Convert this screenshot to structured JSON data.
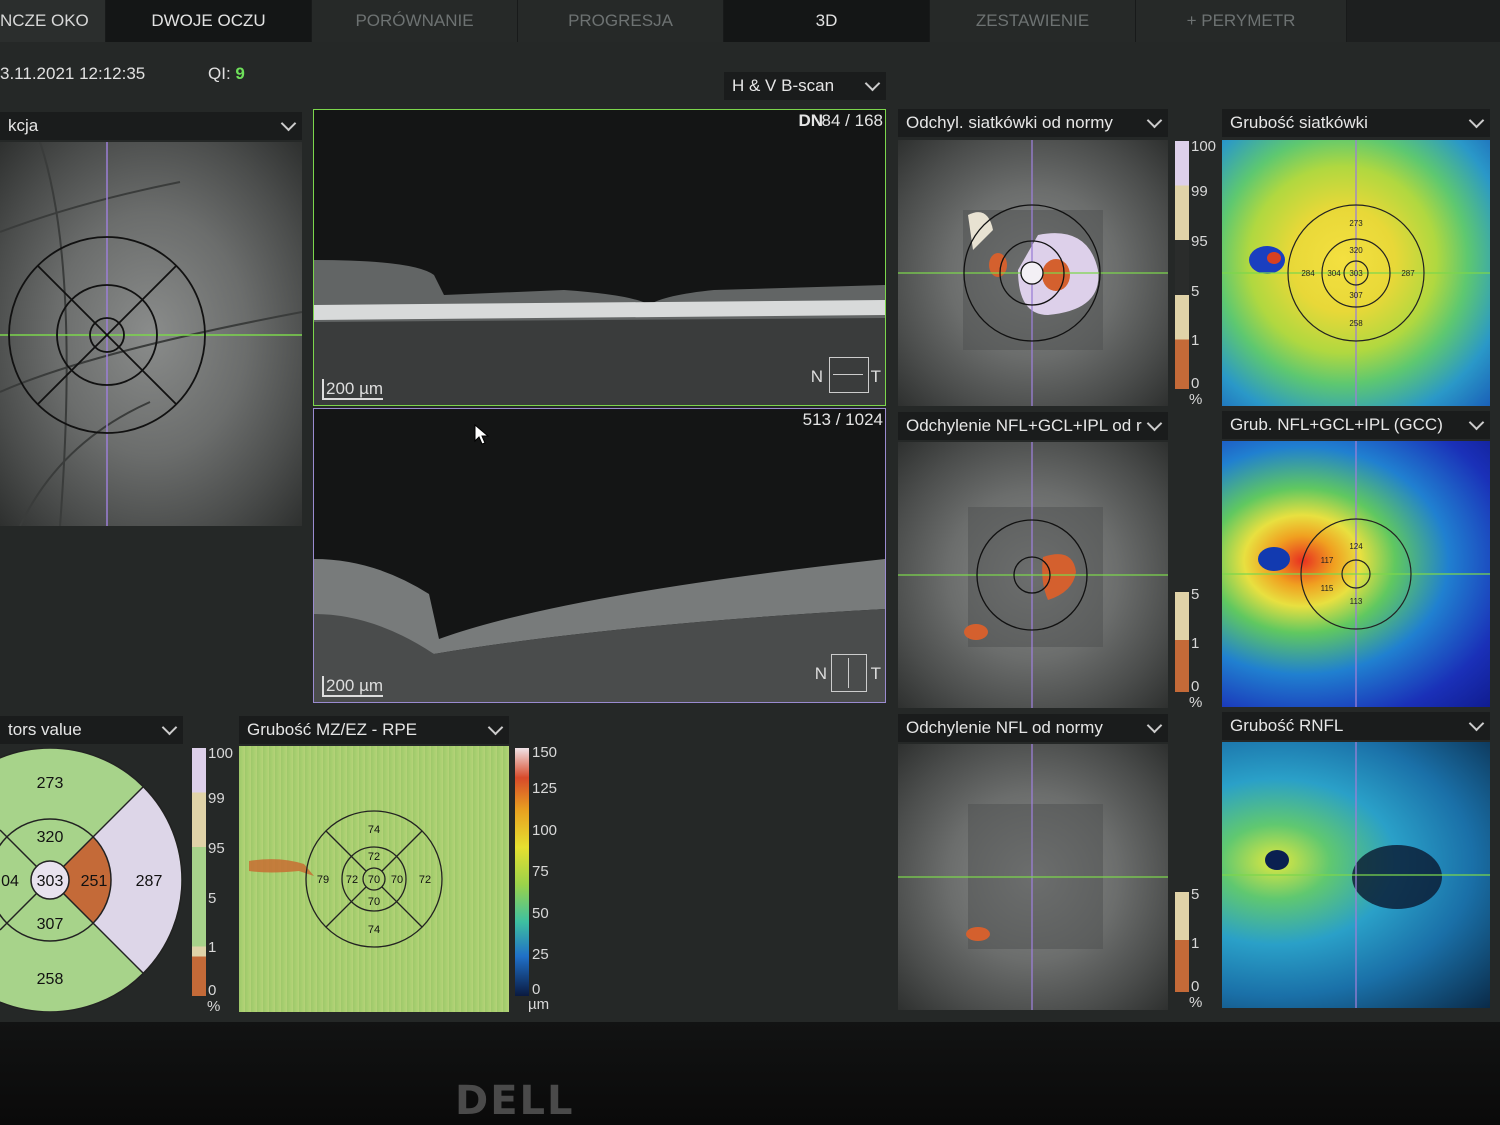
{
  "tabs": [
    "NCZE OKO",
    "DWOJE OCZU",
    "PORÓWNANIE",
    "PROGRESJA",
    "3D",
    "ZESTAWIENIE",
    "+ PERYMETR"
  ],
  "header": {
    "datetime": "3.11.2021 12:12:35",
    "qi_label": "QI:",
    "qi_value": "9"
  },
  "bscan_selector": "H & V B-scan",
  "left_panel": {
    "title": "kcja"
  },
  "horizontal_scan": {
    "direction": "DN",
    "counter": "84 / 168",
    "scale": "200 µm",
    "nasal": "N",
    "temporal": "T"
  },
  "vertical_scan": {
    "counter": "513 / 1024",
    "scale": "200 µm",
    "nasal": "N",
    "temporal": "T"
  },
  "sectors_panel": {
    "title": "tors value",
    "values": {
      "outer_top": "273",
      "inner_top": "320",
      "outer_left": "04",
      "center": "303",
      "inner_right": "251",
      "outer_right": "287",
      "inner_bottom": "307",
      "outer_bottom": "258"
    }
  },
  "percent_legend_a": {
    "labels": [
      "100",
      "99",
      "95",
      "5",
      "1",
      "0",
      "%"
    ]
  },
  "mzez_panel": {
    "title": "Grubość MZ/EZ - RPE",
    "values": {
      "outer_top": "74",
      "inner_top": "72",
      "outer_left": "79",
      "inner_left": "72",
      "center": "70",
      "inner_right": "70",
      "outer_right": "72",
      "inner_bottom": "70",
      "outer_bottom": "74"
    }
  },
  "um_legend": {
    "labels": [
      "150",
      "125",
      "100",
      "75",
      "50",
      "25",
      "0",
      "µm"
    ]
  },
  "right_column_a": [
    {
      "title": "Odchyl. siatkówki od normy"
    },
    {
      "title": "Odchylenie NFL+GCL+IPL od r"
    },
    {
      "title": "Odchylenie NFL od normy"
    }
  ],
  "right_column_b": [
    {
      "title": "Grubość siatkówki",
      "values": [
        "273",
        "320",
        "284",
        "304",
        "303",
        "287",
        "307",
        "258"
      ]
    },
    {
      "title": "Grub. NFL+GCL+IPL (GCC)",
      "values": [
        "124",
        "117",
        "115",
        "113"
      ]
    },
    {
      "title": "Grubość RNFL"
    }
  ],
  "percent_legend_b": {
    "labels": [
      "100",
      "99",
      "95",
      "5",
      "1",
      "0",
      "%"
    ]
  },
  "percent_legend_c": {
    "labels": [
      "5",
      "1",
      "0",
      "%"
    ]
  },
  "percent_legend_d": {
    "labels": [
      "5",
      "1",
      "0",
      "%"
    ]
  },
  "brand": "DELL"
}
